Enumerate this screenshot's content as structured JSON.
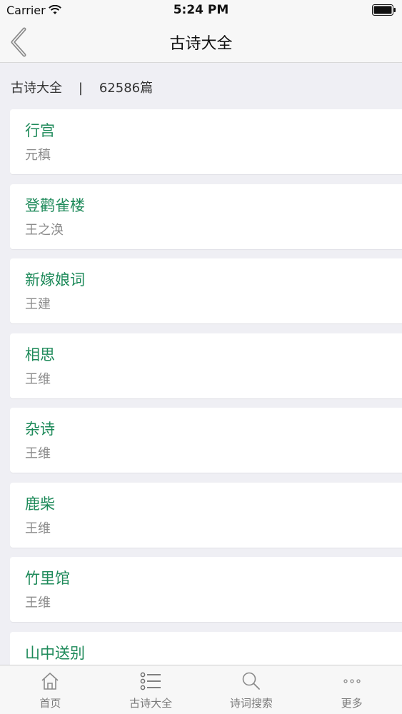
{
  "status_bar": {
    "carrier": "Carrier",
    "time": "5:24 PM"
  },
  "nav": {
    "title": "古诗大全",
    "back_icon": "chevron-left-icon"
  },
  "summary": {
    "label": "古诗大全",
    "separator": "|",
    "count": "62586篇"
  },
  "poems": [
    {
      "title": "行宫",
      "author": "元稹"
    },
    {
      "title": "登鹳雀楼",
      "author": "王之涣"
    },
    {
      "title": "新嫁娘词",
      "author": "王建"
    },
    {
      "title": "相思",
      "author": "王维"
    },
    {
      "title": "杂诗",
      "author": "王维"
    },
    {
      "title": "鹿柴",
      "author": "王维"
    },
    {
      "title": "竹里馆",
      "author": "王维"
    },
    {
      "title": "山中送别",
      "author": ""
    }
  ],
  "tabs": [
    {
      "label": "首页",
      "icon": "home-icon"
    },
    {
      "label": "古诗大全",
      "icon": "list-icon"
    },
    {
      "label": "诗词搜索",
      "icon": "search-icon"
    },
    {
      "label": "更多",
      "icon": "more-icon"
    }
  ],
  "colors": {
    "accent": "#1e8a5a",
    "author": "#8c8c8c",
    "background": "#efeff4"
  }
}
